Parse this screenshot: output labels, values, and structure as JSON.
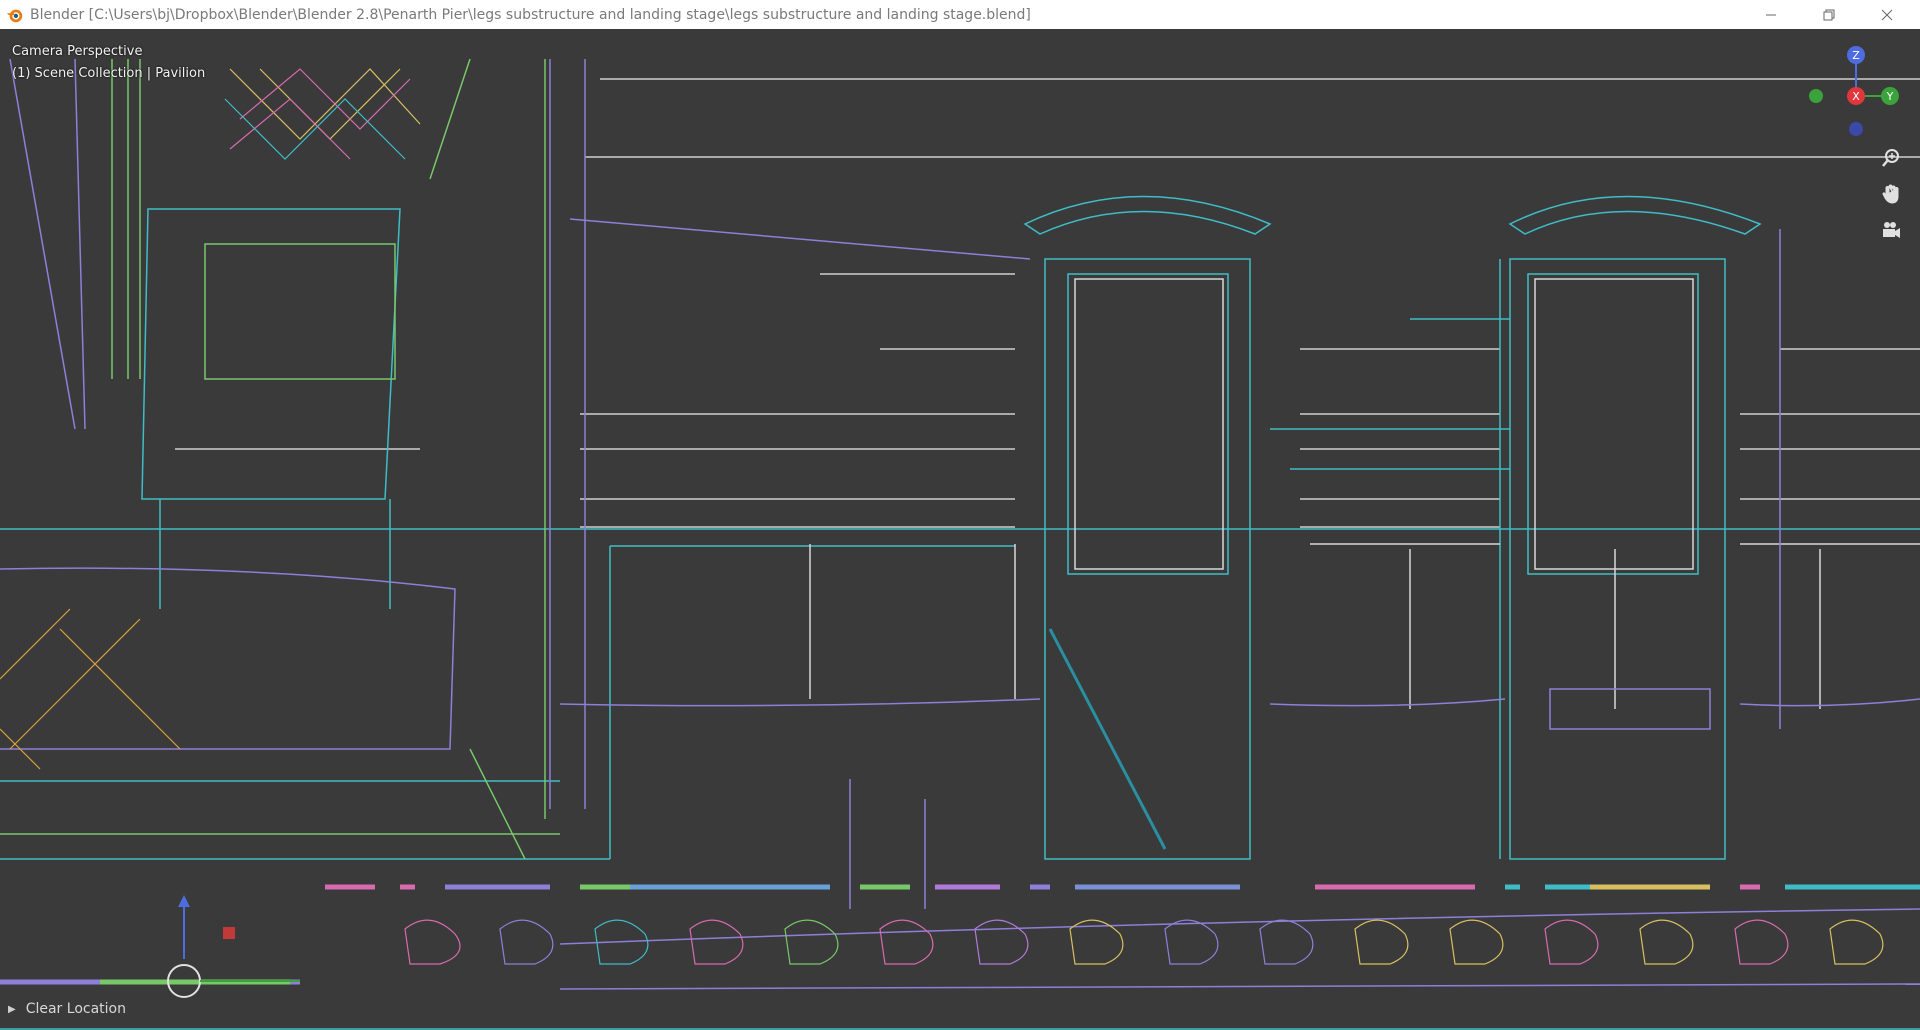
{
  "window": {
    "title": "Blender [C:\\Users\\bj\\Dropbox\\Blender\\Blender 2.8\\Penarth Pier\\legs substructure and landing stage\\legs substructure and landing stage.blend]",
    "controls": {
      "minimize_icon": "minimize-icon",
      "restore_icon": "restore-icon",
      "close_icon": "close-icon"
    }
  },
  "viewport": {
    "view_name": "Camera Perspective",
    "collection_info": "(1) Scene Collection | Pavilion",
    "gizmo": {
      "z_label": "Z",
      "x_label": "X",
      "y_label": "Y",
      "z_color": "#4c6ce0",
      "x_color": "#e0363e",
      "y_color": "#3aa33c"
    },
    "nav_icons": [
      "zoom-icon",
      "hand-icon",
      "camera-icon"
    ]
  },
  "last_operator": {
    "label": "Clear Location",
    "expander_icon": "triangle-right-icon"
  },
  "colors": {
    "teal": "#3fbcc6",
    "purple": "#8e7fd8",
    "green": "#78c86a",
    "pink": "#d86ab0",
    "yellow": "#d8c060",
    "white_line": "#d0d0d0"
  }
}
